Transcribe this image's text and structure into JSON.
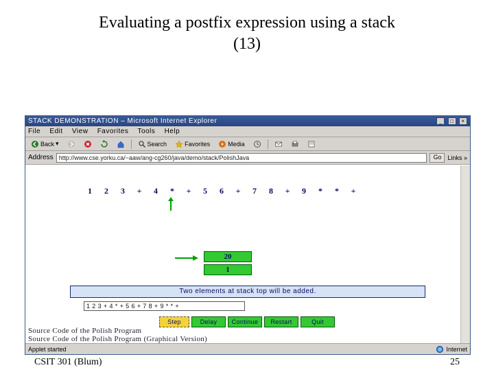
{
  "slide": {
    "title_line1": "Evaluating a postfix expression using a stack",
    "title_line2": "(13)",
    "footer_left": "CSIT 301 (Blum)",
    "footer_right": "25"
  },
  "browser": {
    "title": "STACK DEMONSTRATION – Microsoft Internet Explorer",
    "menu": [
      "File",
      "Edit",
      "View",
      "Favorites",
      "Tools",
      "Help"
    ],
    "toolbar": {
      "back": "Back",
      "search": "Search",
      "favorites": "Favorites",
      "media": "Media"
    },
    "address_label": "Address",
    "url": "http://www.cse.yorku.ca/~aaw/ang-cg260/java/demo/stack/PolishJava",
    "go": "Go",
    "links": "Links »",
    "status_left": "Applet started",
    "status_right": "Internet"
  },
  "applet": {
    "tokens": [
      "1",
      "2",
      "3",
      "+",
      "4",
      "*",
      "+",
      "5",
      "6",
      "+",
      "7",
      "8",
      "+",
      "9",
      "*",
      "*",
      "+"
    ],
    "stack": {
      "top": "20",
      "below": "1"
    },
    "message": "Two elements at stack top will be added.",
    "input": "1 2 3 + 4 * + 5 6 + 7 8 + 9 * * +",
    "buttons": {
      "step": "Step",
      "delay": "Delay",
      "continue": "Continue",
      "restart": "Restart",
      "quit": "Quit"
    },
    "source_links": [
      "Source Code of the Polish Program",
      "Source Code of the Polish Program (Graphical Version)"
    ]
  }
}
